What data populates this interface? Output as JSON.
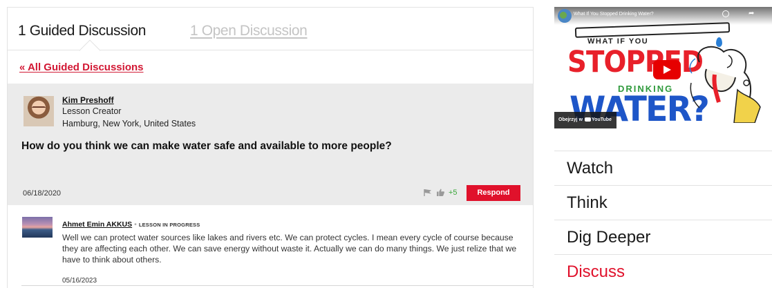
{
  "tabs": {
    "guided": "1 Guided Discussion",
    "open": "1 Open Discussion"
  },
  "back_link": "« All Guided Discussions",
  "question": {
    "author": "Kim Preshoff",
    "role": "Lesson Creator",
    "location": "Hamburg, New York, United States",
    "text": "How do you think we can make water safe and available to more people?",
    "date": "06/18/2020",
    "likes": "+5",
    "respond_label": "Respond"
  },
  "reply": {
    "author": "Ahmet Emin AKKUS",
    "separator": "•",
    "status": "LESSON IN PROGRESS",
    "text": "Well we can protect water sources like lakes and rivers etc. We can protect cycles. I mean every cycle of course because they are affecting each other. We can save energy without waste it. Actually we can do many things. We just relize that we have to think about others.",
    "date": "05/16/2023"
  },
  "video": {
    "title": "What If You Stopped Drinking Water?",
    "art_line1": "WHAT IF YOU",
    "art_line2": "STOPPED",
    "art_line3": "DRINKING",
    "art_line4": "WATER?",
    "watch_on_prefix": "Obejrzyj w",
    "watch_on_brand": "YouTube"
  },
  "nav": {
    "items": [
      "Watch",
      "Think",
      "Dig Deeper",
      "Discuss"
    ],
    "active": "Discuss"
  },
  "colors": {
    "accent_red": "#e0112b",
    "likes_green": "#3aa63a",
    "panel_gray": "#ebebeb"
  }
}
